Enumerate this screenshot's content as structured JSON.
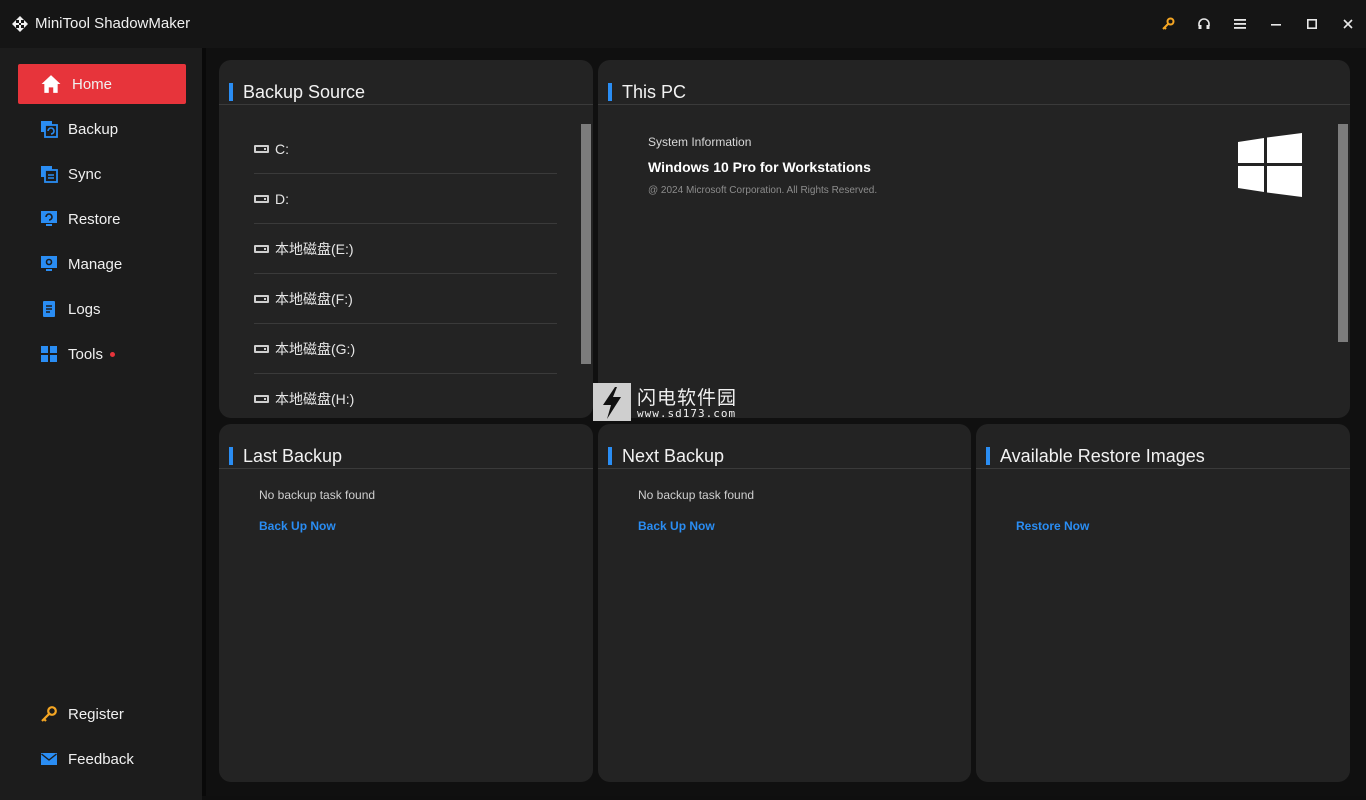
{
  "window": {
    "title": "MiniTool ShadowMaker",
    "controls": [
      "key-icon",
      "headphones-icon",
      "menu-icon",
      "minimize-icon",
      "maximize-icon",
      "close-icon"
    ]
  },
  "sidebar": {
    "items": [
      {
        "label": "Home",
        "icon": "home-icon",
        "active": true
      },
      {
        "label": "Backup",
        "icon": "backup-icon"
      },
      {
        "label": "Sync",
        "icon": "sync-icon"
      },
      {
        "label": "Restore",
        "icon": "restore-icon"
      },
      {
        "label": "Manage",
        "icon": "manage-icon"
      },
      {
        "label": "Logs",
        "icon": "logs-icon"
      },
      {
        "label": "Tools",
        "icon": "tools-icon",
        "badge": true
      }
    ],
    "footer": [
      {
        "label": "Register",
        "icon": "key-icon"
      },
      {
        "label": "Feedback",
        "icon": "mail-icon"
      }
    ]
  },
  "backup_source": {
    "title": "Backup Source",
    "drives": [
      "C:",
      "D:",
      "本地磁盘(E:)",
      "本地磁盘(F:)",
      "本地磁盘(G:)",
      "本地磁盘(H:)"
    ]
  },
  "this_pc": {
    "title": "This PC",
    "label": "System Information",
    "os": "Windows 10 Pro for Workstations",
    "copyright": "@ 2024 Microsoft Corporation. All Rights Reserved."
  },
  "last_backup": {
    "title": "Last Backup",
    "note": "No backup task found",
    "action": "Back Up Now"
  },
  "next_backup": {
    "title": "Next Backup",
    "note": "No backup task found",
    "action": "Back Up Now"
  },
  "restore_images": {
    "title": "Available Restore Images",
    "action": "Restore Now"
  },
  "watermark": {
    "cn": "闪电软件园",
    "url": "www.sd173.com"
  },
  "colors": {
    "accent": "#e7343b",
    "link": "#2a8df3",
    "panel": "#232323",
    "background": "#101010"
  }
}
